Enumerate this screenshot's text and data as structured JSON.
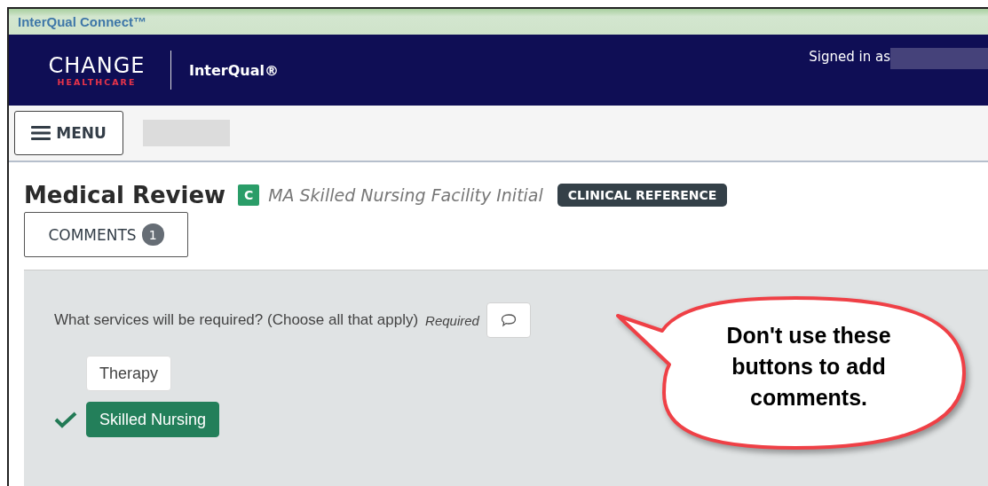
{
  "window": {
    "title": "InterQual Connect™"
  },
  "header": {
    "logo_word": "CHANGE",
    "logo_subword": "HEALTHCARE",
    "product": "InterQual®",
    "signed_in_label": "Signed in as"
  },
  "toolbar": {
    "menu_button": "MENU"
  },
  "review": {
    "title": "Medical Review",
    "type_badge": "C",
    "subset": "MA Skilled Nursing Facility Initial",
    "tag": "CLINICAL REFERENCE",
    "comments_button": "COMMENTS",
    "comments_count": "1"
  },
  "question": {
    "text": "What services will be required? (Choose all that apply)",
    "required": "Required",
    "options": [
      {
        "label": "Therapy",
        "selected": false
      },
      {
        "label": "Skilled Nursing",
        "selected": true
      }
    ]
  },
  "callout": {
    "text": "Don't use these buttons to add comments."
  }
}
